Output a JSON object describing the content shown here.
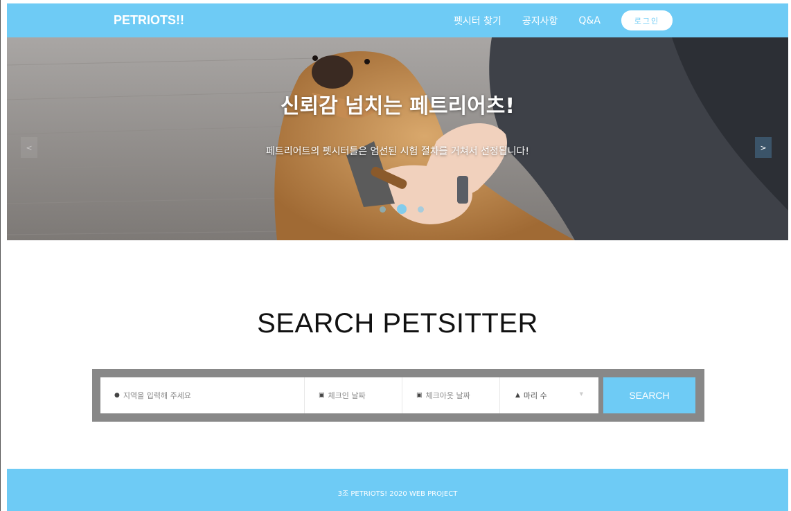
{
  "header": {
    "brand": "PETRIOTS!!",
    "nav": [
      "펫시터 찾기",
      "공지사항",
      "Q&A"
    ],
    "login_label": "로그인"
  },
  "hero": {
    "title": "신뢰감 넘치는 페트리어츠!",
    "subtitle": "페트리어트의 펫시터들은 엄선된 시험 절차를 거쳐서 선정됩니다!",
    "prev_arrow": "<",
    "next_arrow": ">",
    "active_slide": 2,
    "slide_count": 3
  },
  "search": {
    "title": "SEARCH PETSITTER",
    "location_placeholder": "지역을 입력해 주세요",
    "checkin_placeholder": "체크인 날짜",
    "checkout_placeholder": "체크아웃 날짜",
    "pets_label": "마리 수",
    "button_label": "SEARCH"
  },
  "footer": {
    "text": "3조 PETRIOTS! 2020 WEB PROJECT"
  },
  "colors": {
    "accent": "#6ecbf5",
    "search_frame": "#888888"
  },
  "icons": {
    "location": "map-pin-icon",
    "calendar": "calendar-icon",
    "person": "person-icon",
    "caret": "chevron-down-icon"
  }
}
